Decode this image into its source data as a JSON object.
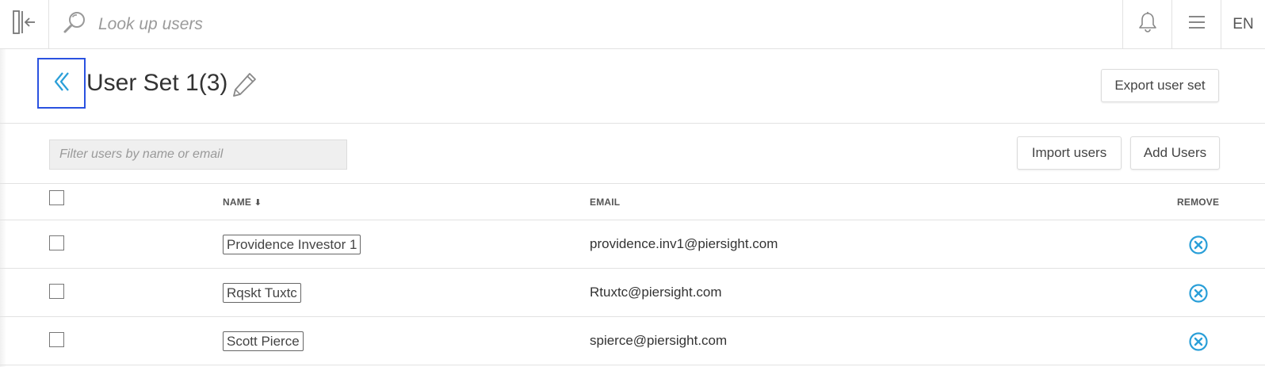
{
  "search": {
    "placeholder": "Look up users"
  },
  "top_bar": {
    "language": "EN"
  },
  "header": {
    "title": "User Set 1(3)",
    "export_label": "Export user set"
  },
  "filter": {
    "placeholder": "Filter users by name or email"
  },
  "actions": {
    "import_label": "Import users",
    "add_label": "Add Users"
  },
  "table": {
    "columns": {
      "name": "NAME",
      "sort_icon": "⬇",
      "email": "EMAIL",
      "remove": "REMOVE"
    },
    "rows": [
      {
        "name": "Providence Investor 1",
        "email": "providence.inv1@piersight.com"
      },
      {
        "name": "Rqskt Tuxtc",
        "email": "Rtuxtc@piersight.com"
      },
      {
        "name": "Scott Pierce",
        "email": "spierce@piersight.com"
      }
    ]
  },
  "colors": {
    "accent": "#2a9fd8",
    "focus_border": "#2a52e0"
  }
}
